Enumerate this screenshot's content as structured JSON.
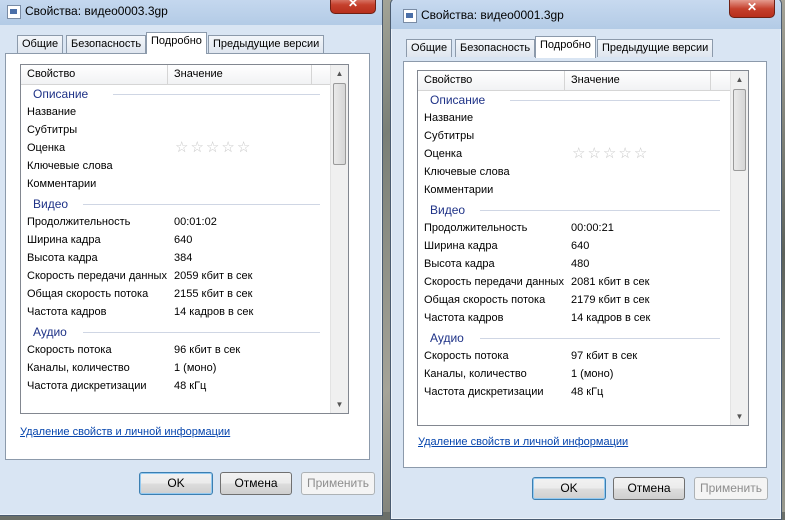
{
  "windows": [
    {
      "title": "Свойства: видео0003.3gp",
      "close": "✕",
      "tabs": [
        "Общие",
        "Безопасность",
        "Подробно",
        "Предыдущие версии"
      ],
      "header": {
        "property": "Свойство",
        "value": "Значение"
      },
      "groups": [
        {
          "name": "Описание",
          "rows": [
            [
              "Название",
              ""
            ],
            [
              "Субтитры",
              ""
            ],
            [
              "Оценка",
              "stars"
            ],
            [
              "Ключевые слова",
              ""
            ],
            [
              "Комментарии",
              ""
            ]
          ]
        },
        {
          "name": "Видео",
          "rows": [
            [
              "Продолжительность",
              "00:01:02"
            ],
            [
              "Ширина кадра",
              "640"
            ],
            [
              "Высота кадра",
              "384"
            ],
            [
              "Скорость передачи данных",
              "2059 кбит в сек"
            ],
            [
              "Общая скорость потока",
              "2155 кбит в сек"
            ],
            [
              "Частота кадров",
              "14 кадров в сек"
            ]
          ]
        },
        {
          "name": "Аудио",
          "rows": [
            [
              "Скорость потока",
              "96 кбит в сек"
            ],
            [
              "Каналы, количество",
              "1 (моно)"
            ],
            [
              "Частота дискретизации",
              "48 кГц"
            ]
          ]
        }
      ],
      "link": "Удаление свойств и личной информации",
      "buttons": {
        "ok": "OK",
        "cancel": "Отмена",
        "apply": "Применить"
      }
    },
    {
      "title": "Свойства: видео0001.3gp",
      "close": "✕",
      "tabs": [
        "Общие",
        "Безопасность",
        "Подробно",
        "Предыдущие версии"
      ],
      "header": {
        "property": "Свойство",
        "value": "Значение"
      },
      "groups": [
        {
          "name": "Описание",
          "rows": [
            [
              "Название",
              ""
            ],
            [
              "Субтитры",
              ""
            ],
            [
              "Оценка",
              "stars"
            ],
            [
              "Ключевые слова",
              ""
            ],
            [
              "Комментарии",
              ""
            ]
          ]
        },
        {
          "name": "Видео",
          "rows": [
            [
              "Продолжительность",
              "00:00:21"
            ],
            [
              "Ширина кадра",
              "640"
            ],
            [
              "Высота кадра",
              "480"
            ],
            [
              "Скорость передачи данных",
              "2081 кбит в сек"
            ],
            [
              "Общая скорость потока",
              "2179 кбит в сек"
            ],
            [
              "Частота кадров",
              "14 кадров в сек"
            ]
          ]
        },
        {
          "name": "Аудио",
          "rows": [
            [
              "Скорость потока",
              "97 кбит в сек"
            ],
            [
              "Каналы, количество",
              "1 (моно)"
            ],
            [
              "Частота дискретизации",
              "48 кГц"
            ]
          ]
        }
      ],
      "link": "Удаление свойств и личной информации",
      "buttons": {
        "ok": "OK",
        "cancel": "Отмена",
        "apply": "Применить"
      }
    }
  ],
  "rating": {
    "stars": 5,
    "filled": 0
  },
  "colors": {
    "group_text": "#1e3287",
    "link": "#0645ad",
    "close_button": "#c5402c"
  }
}
